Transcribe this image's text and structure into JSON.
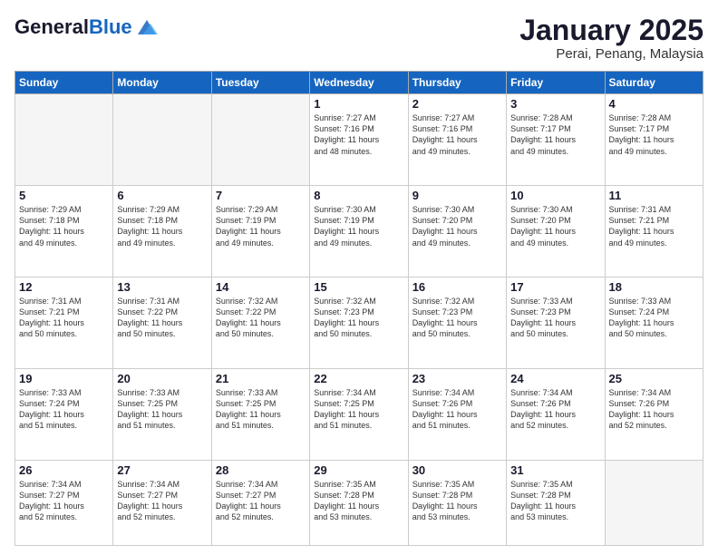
{
  "logo": {
    "general": "General",
    "blue": "Blue"
  },
  "header": {
    "title": "January 2025",
    "location": "Perai, Penang, Malaysia"
  },
  "weekdays": [
    "Sunday",
    "Monday",
    "Tuesday",
    "Wednesday",
    "Thursday",
    "Friday",
    "Saturday"
  ],
  "weeks": [
    [
      {
        "day": "",
        "info": ""
      },
      {
        "day": "",
        "info": ""
      },
      {
        "day": "",
        "info": ""
      },
      {
        "day": "1",
        "info": "Sunrise: 7:27 AM\nSunset: 7:16 PM\nDaylight: 11 hours\nand 48 minutes."
      },
      {
        "day": "2",
        "info": "Sunrise: 7:27 AM\nSunset: 7:16 PM\nDaylight: 11 hours\nand 49 minutes."
      },
      {
        "day": "3",
        "info": "Sunrise: 7:28 AM\nSunset: 7:17 PM\nDaylight: 11 hours\nand 49 minutes."
      },
      {
        "day": "4",
        "info": "Sunrise: 7:28 AM\nSunset: 7:17 PM\nDaylight: 11 hours\nand 49 minutes."
      }
    ],
    [
      {
        "day": "5",
        "info": "Sunrise: 7:29 AM\nSunset: 7:18 PM\nDaylight: 11 hours\nand 49 minutes."
      },
      {
        "day": "6",
        "info": "Sunrise: 7:29 AM\nSunset: 7:18 PM\nDaylight: 11 hours\nand 49 minutes."
      },
      {
        "day": "7",
        "info": "Sunrise: 7:29 AM\nSunset: 7:19 PM\nDaylight: 11 hours\nand 49 minutes."
      },
      {
        "day": "8",
        "info": "Sunrise: 7:30 AM\nSunset: 7:19 PM\nDaylight: 11 hours\nand 49 minutes."
      },
      {
        "day": "9",
        "info": "Sunrise: 7:30 AM\nSunset: 7:20 PM\nDaylight: 11 hours\nand 49 minutes."
      },
      {
        "day": "10",
        "info": "Sunrise: 7:30 AM\nSunset: 7:20 PM\nDaylight: 11 hours\nand 49 minutes."
      },
      {
        "day": "11",
        "info": "Sunrise: 7:31 AM\nSunset: 7:21 PM\nDaylight: 11 hours\nand 49 minutes."
      }
    ],
    [
      {
        "day": "12",
        "info": "Sunrise: 7:31 AM\nSunset: 7:21 PM\nDaylight: 11 hours\nand 50 minutes."
      },
      {
        "day": "13",
        "info": "Sunrise: 7:31 AM\nSunset: 7:22 PM\nDaylight: 11 hours\nand 50 minutes."
      },
      {
        "day": "14",
        "info": "Sunrise: 7:32 AM\nSunset: 7:22 PM\nDaylight: 11 hours\nand 50 minutes."
      },
      {
        "day": "15",
        "info": "Sunrise: 7:32 AM\nSunset: 7:23 PM\nDaylight: 11 hours\nand 50 minutes."
      },
      {
        "day": "16",
        "info": "Sunrise: 7:32 AM\nSunset: 7:23 PM\nDaylight: 11 hours\nand 50 minutes."
      },
      {
        "day": "17",
        "info": "Sunrise: 7:33 AM\nSunset: 7:23 PM\nDaylight: 11 hours\nand 50 minutes."
      },
      {
        "day": "18",
        "info": "Sunrise: 7:33 AM\nSunset: 7:24 PM\nDaylight: 11 hours\nand 50 minutes."
      }
    ],
    [
      {
        "day": "19",
        "info": "Sunrise: 7:33 AM\nSunset: 7:24 PM\nDaylight: 11 hours\nand 51 minutes."
      },
      {
        "day": "20",
        "info": "Sunrise: 7:33 AM\nSunset: 7:25 PM\nDaylight: 11 hours\nand 51 minutes."
      },
      {
        "day": "21",
        "info": "Sunrise: 7:33 AM\nSunset: 7:25 PM\nDaylight: 11 hours\nand 51 minutes."
      },
      {
        "day": "22",
        "info": "Sunrise: 7:34 AM\nSunset: 7:25 PM\nDaylight: 11 hours\nand 51 minutes."
      },
      {
        "day": "23",
        "info": "Sunrise: 7:34 AM\nSunset: 7:26 PM\nDaylight: 11 hours\nand 51 minutes."
      },
      {
        "day": "24",
        "info": "Sunrise: 7:34 AM\nSunset: 7:26 PM\nDaylight: 11 hours\nand 52 minutes."
      },
      {
        "day": "25",
        "info": "Sunrise: 7:34 AM\nSunset: 7:26 PM\nDaylight: 11 hours\nand 52 minutes."
      }
    ],
    [
      {
        "day": "26",
        "info": "Sunrise: 7:34 AM\nSunset: 7:27 PM\nDaylight: 11 hours\nand 52 minutes."
      },
      {
        "day": "27",
        "info": "Sunrise: 7:34 AM\nSunset: 7:27 PM\nDaylight: 11 hours\nand 52 minutes."
      },
      {
        "day": "28",
        "info": "Sunrise: 7:34 AM\nSunset: 7:27 PM\nDaylight: 11 hours\nand 52 minutes."
      },
      {
        "day": "29",
        "info": "Sunrise: 7:35 AM\nSunset: 7:28 PM\nDaylight: 11 hours\nand 53 minutes."
      },
      {
        "day": "30",
        "info": "Sunrise: 7:35 AM\nSunset: 7:28 PM\nDaylight: 11 hours\nand 53 minutes."
      },
      {
        "day": "31",
        "info": "Sunrise: 7:35 AM\nSunset: 7:28 PM\nDaylight: 11 hours\nand 53 minutes."
      },
      {
        "day": "",
        "info": ""
      }
    ]
  ]
}
